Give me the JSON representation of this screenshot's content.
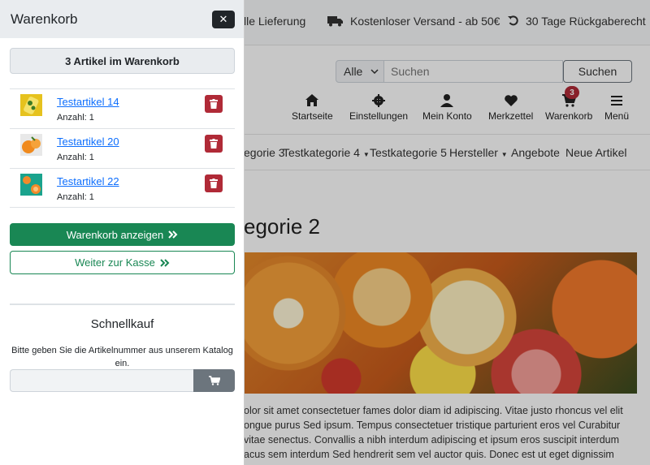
{
  "background": {
    "topbar": {
      "delivery": "lle Lieferung",
      "shipping": "Kostenloser Versand - ab 50€",
      "returns": "30 Tage Rückgaberecht"
    },
    "search": {
      "category": "Alle",
      "placeholder": "Suchen",
      "button": "Suchen"
    },
    "nav": {
      "home": "Startseite",
      "settings": "Einstellungen",
      "account": "Mein Konto",
      "wishlist": "Merkzettel",
      "cart": "Warenkorb",
      "cart_count": "3",
      "menu": "Menü"
    },
    "categories": [
      "egorie 3",
      "Testkategorie 4",
      "Testkategorie 5",
      "Hersteller",
      "Angebote",
      "Neue Artikel"
    ],
    "heading": "egorie 2",
    "body_lines": [
      "olor sit amet consectetuer fames dolor diam id adipiscing. Vitae justo rhoncus vel elit",
      "ongue purus Sed ipsum. Tempus consectetuer tristique parturient eros vel Curabitur",
      "vitae senectus. Convallis a nibh interdum adipiscing et ipsum eros suscipit interdum",
      "acus sem interdum Sed hendrerit sem vel auctor quis. Donec est ut eget dignissim"
    ]
  },
  "drawer": {
    "title": "Warenkorb",
    "count_label": "3 Artikel im Warenkorb",
    "items": [
      {
        "name": "Testartikel 14",
        "qty": "Anzahl: 1"
      },
      {
        "name": "Testartikel 20",
        "qty": "Anzahl: 1"
      },
      {
        "name": "Testartikel 22",
        "qty": "Anzahl: 1"
      }
    ],
    "show_cart_button": "Warenkorb anzeigen",
    "checkout_button": "Weiter zur Kasse",
    "quick_buy": {
      "title": "Schnellkauf",
      "description": "Bitte geben Sie die Artikelnummer aus unserem Katalog ein."
    }
  },
  "colors": {
    "primary_green": "#198754",
    "danger": "#b02a37",
    "link": "#0d6efd",
    "dark": "#212529"
  }
}
